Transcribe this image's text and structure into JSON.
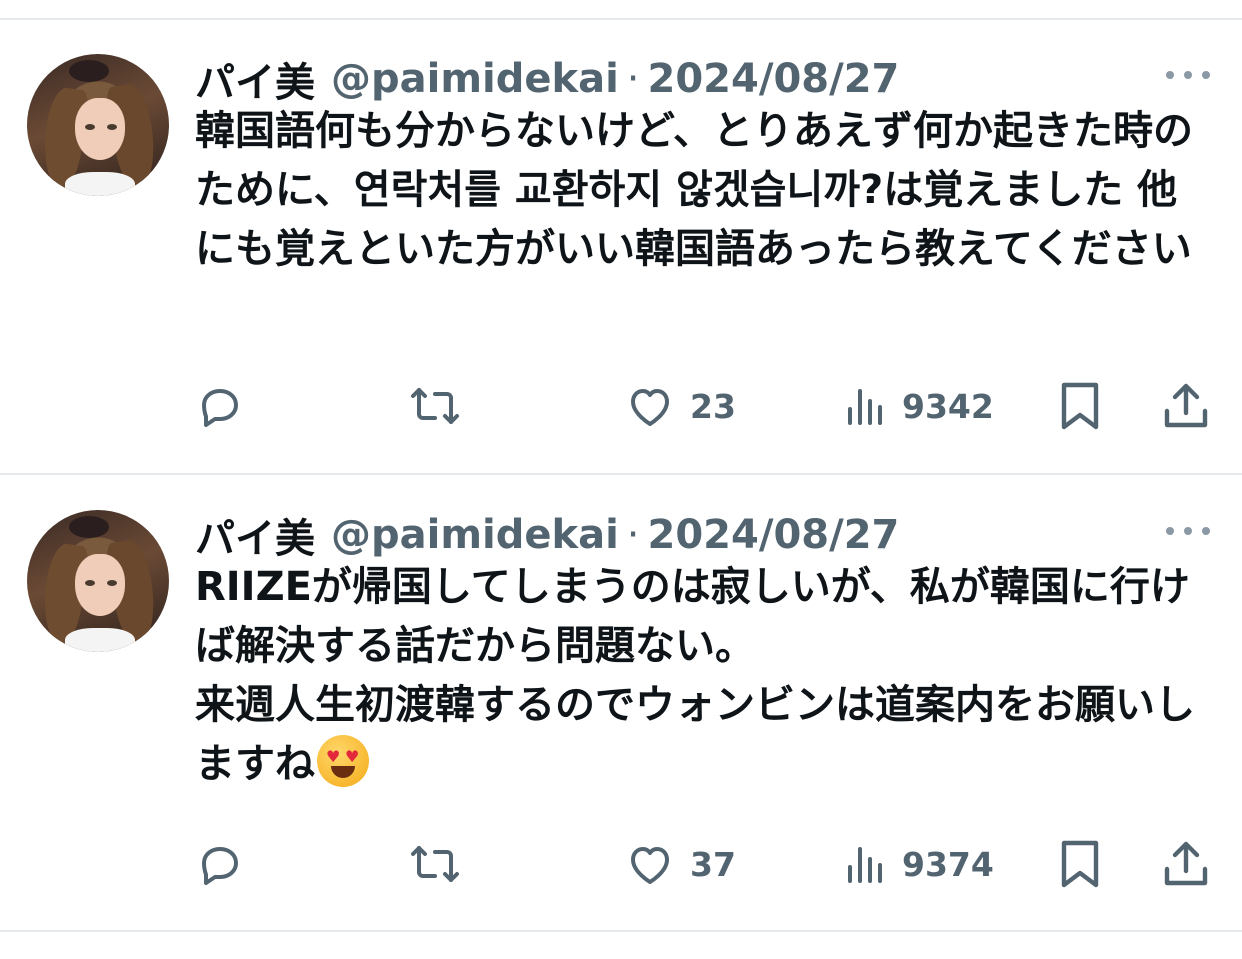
{
  "tweets": [
    {
      "name": "パイ美",
      "handle": "@paimidekai",
      "separator": "·",
      "date": "2024/08/27",
      "text": "韓国語何も分からないけど、とりあえず何か起きた時のために、연락처를 교환하지 않겠습니까?は覚えました 他にも覚えといた方がいい韓国語あったら教えてください",
      "likes": "23",
      "views": "9342"
    },
    {
      "name": "パイ美",
      "handle": "@paimidekai",
      "separator": "·",
      "date": "2024/08/27",
      "text": "RIIZEが帰国してしまうのは寂しいが、私が韓国に行けば解決する話だから問題ない。\n来週人生初渡韓するのでウォンビンは道案内をお願いしますね",
      "emoji": "smiling-face-with-heart-eyes",
      "likes": "37",
      "views": "9374"
    }
  ],
  "colors": {
    "text_primary": "#0f1419",
    "text_secondary": "#536471",
    "divider": "#e6e9ec",
    "icon": "#536471"
  },
  "icons": [
    "reply-icon",
    "retweet-icon",
    "like-icon",
    "views-icon",
    "bookmark-icon",
    "share-icon",
    "more-icon"
  ]
}
